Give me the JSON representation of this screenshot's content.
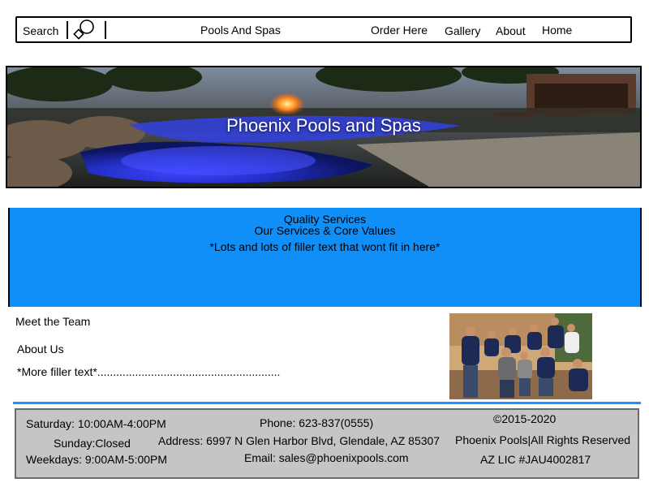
{
  "nav": {
    "search_label": "Search",
    "site_title": "Pools And Spas",
    "links": [
      "Order Here",
      "Gallery",
      "About",
      "Home"
    ]
  },
  "hero": {
    "title": "Phoenix Pools and Spas"
  },
  "services": {
    "heading": "Quality Services",
    "subheading": "Our Services & Core Values",
    "body": "*Lots and lots of filler text that wont fit in here*"
  },
  "team": {
    "meet_heading": "Meet the Team",
    "about_heading": "About Us",
    "filler": "*More filler text*.........................................................."
  },
  "footer": {
    "hours": [
      "Saturday: 10:00AM-4:00PM",
      "Sunday:Closed",
      "Weekdays: 9:00AM-5:00PM"
    ],
    "phone": "Phone: 623-837(0555)",
    "address": "Address: 6997 N Glen Harbor Blvd, Glendale, AZ 85307",
    "email": "Email: sales@phoenixpools.com",
    "copyright": "©2015-2020",
    "rights": "Phoenix Pools|All Rights Reserved",
    "license": "AZ LIC #JAU4002817"
  },
  "colors": {
    "accent_blue": "#0f8ff7",
    "divider_blue": "#1e90ff",
    "footer_bg": "#c5c5c5"
  }
}
